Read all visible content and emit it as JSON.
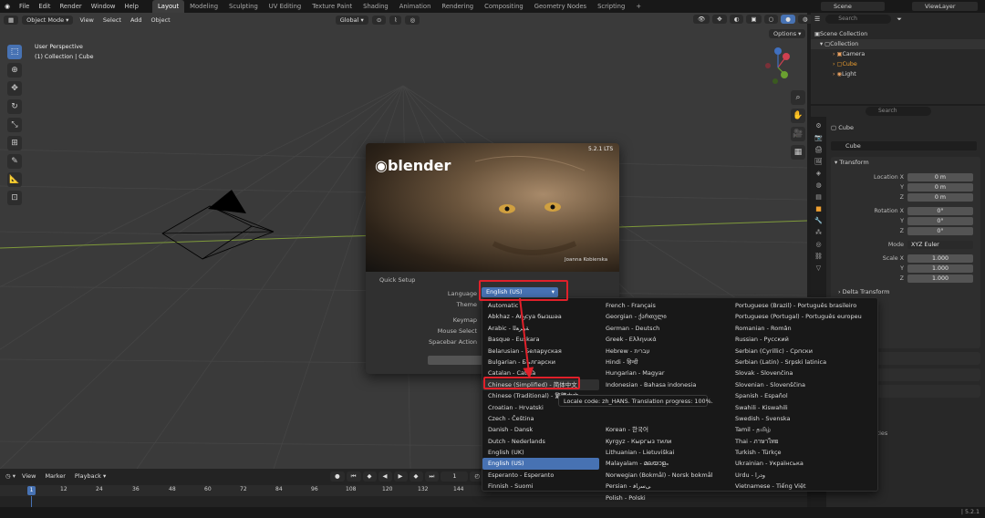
{
  "menubar": {
    "items": [
      "File",
      "Edit",
      "Render",
      "Window",
      "Help"
    ],
    "workspaces": [
      "Layout",
      "Modeling",
      "Sculpting",
      "UV Editing",
      "Texture Paint",
      "Shading",
      "Animation",
      "Rendering",
      "Compositing",
      "Geometry Nodes",
      "Scripting"
    ],
    "scene": "Scene",
    "view_layer": "ViewLayer"
  },
  "viewport": {
    "mode": "Object Mode",
    "menus": [
      "View",
      "Select",
      "Add",
      "Object"
    ],
    "orientation": "Global",
    "options": "Options",
    "perspective": "User Perspective",
    "collection_info": "(1) Collection | Cube"
  },
  "outliner": {
    "search_placeholder": "Search",
    "root": "Scene Collection",
    "collection": "Collection",
    "objects": [
      "Camera",
      "Cube",
      "Light"
    ]
  },
  "properties": {
    "search_placeholder": "Search",
    "object_name": "Cube",
    "object_field": "Cube",
    "transform_label": "Transform",
    "location": {
      "label": "Location X",
      "x": "0 m",
      "y": "0 m",
      "z": "0 m"
    },
    "rotation": {
      "label": "Rotation X",
      "x": "0°",
      "y": "0°",
      "z": "0°"
    },
    "mode_label": "Mode",
    "mode_value": "XYZ Euler",
    "scale": {
      "label": "Scale X",
      "x": "1.000",
      "y": "1.000",
      "z": "1.000"
    },
    "axis_y": "Y",
    "axis_z": "Z",
    "delta": "Delta Transform",
    "partial_1": "lay",
    "partial_2": "rties"
  },
  "splash": {
    "version": "5.2.1 LTS",
    "logo": "blender",
    "credit": "Joanna Kobierska",
    "quick_setup": "Quick Setup",
    "language_label": "Language",
    "language_value": "English (US)",
    "theme_label": "Theme",
    "keymap_label": "Keymap",
    "mouse_label": "Mouse Select",
    "spacebar_label": "Spacebar Action",
    "continue_partial": "C"
  },
  "languages": {
    "col1": [
      "Automatic",
      "Abkhaz - Аҧсуа бызшәа",
      "Arabic - ﺔﻴﺑﺮﻌﻟﺍ",
      "Basque - Euskara",
      "Belarusian - Беларуская",
      "Bulgarian - Български",
      "Catalan - Català",
      "Chinese (Simplified) - 简体中文",
      "Chinese (Traditional) - 繁體中文",
      "Croatian - Hrvatski",
      "Czech - Čeština",
      "Danish - Dansk",
      "Dutch - Nederlands",
      "English (UK)",
      "English (US)",
      "Esperanto - Esperanto",
      "Finnish - Suomi"
    ],
    "col2": [
      "French - Français",
      "Georgian - ქართული",
      "German - Deutsch",
      "Greek - Ελληνικά",
      "Hebrew - עברית",
      "Hindi - हिन्दी",
      "Hungarian - Magyar",
      "Indonesian - Bahasa indonesia",
      "",
      "",
      "",
      "Korean - 한국어",
      "Kyrgyz - Кыргыз тили",
      "Lithuanian - Lietuviškai",
      "Malayalam - മലയാളം",
      "Norwegian (Bokmål) - Norsk bokmål",
      "Persian - ﯽﺳﺭﺎﻓ",
      "Polish - Polski"
    ],
    "col3": [
      "Portuguese (Brazil) - Português brasileiro",
      "Portuguese (Portugal) - Português europeu",
      "Romanian - Român",
      "Russian - Русский",
      "Serbian (Cyrillic) - Српски",
      "Serbian (Latin) - Srpski latinica",
      "Slovak - Slovenčina",
      "Slovenian - Slovenščina",
      "Spanish - Español",
      "Swahili - Kiswahili",
      "Swedish - Svenska",
      "Tamil - தமிழ்",
      "Thai - ภาษาไทย",
      "Turkish - Türkçe",
      "Ukrainian - Українська",
      "Urdu - ﻭﺩﺭﺍ",
      "Vietnamese - Tiếng Việt"
    ]
  },
  "tooltip": "Locale code: zh_HANS. Translation progress: 100%.",
  "timeline": {
    "menus": [
      "View",
      "Marker",
      "Playback"
    ],
    "frames": [
      "1",
      "12",
      "24",
      "36",
      "48",
      "60",
      "72",
      "84",
      "96",
      "108",
      "120",
      "132",
      "144"
    ],
    "current": "1"
  },
  "statusbar": {
    "version": "5.2.1"
  },
  "colors": {
    "accent": "#4772b3",
    "highlight": "#e0202a",
    "active_object": "#f0a030"
  }
}
